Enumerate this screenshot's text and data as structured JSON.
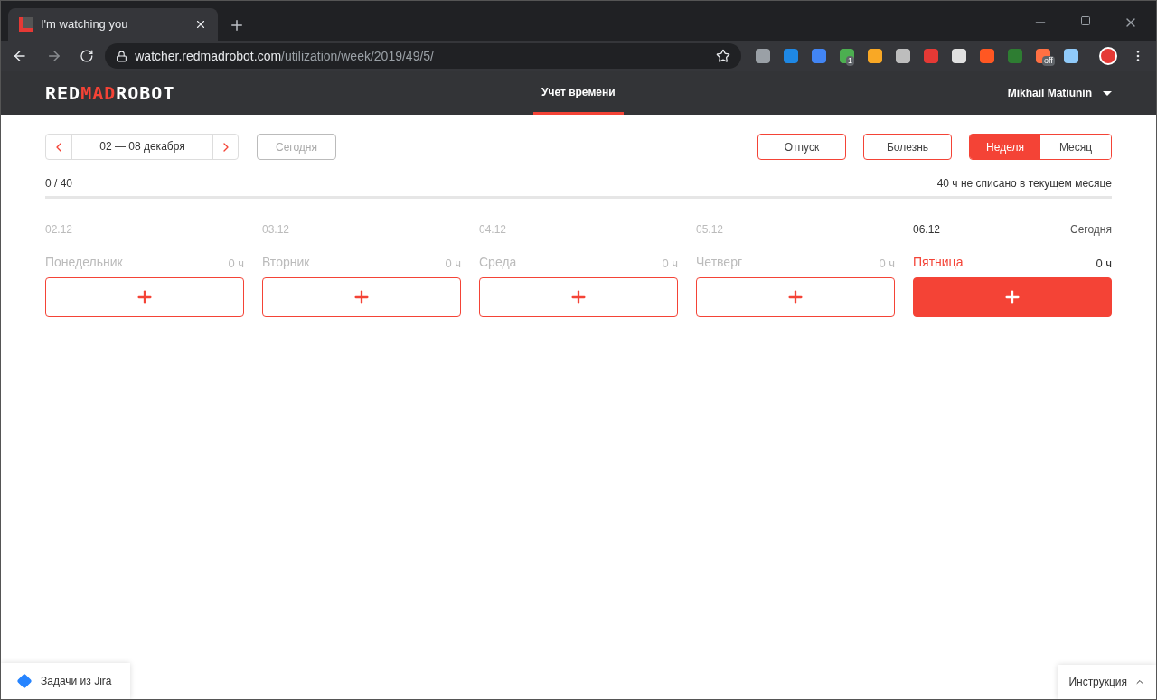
{
  "browser": {
    "tab_title": "I'm watching you",
    "url_host": "watcher.redmadrobot.com",
    "url_path": "/utilization/week/2019/49/5/",
    "extensions": [
      {
        "color": "#9aa0a6"
      },
      {
        "color": "#1e88e5"
      },
      {
        "color": "#4285f4"
      },
      {
        "color": "#4caf50",
        "badge": "1"
      },
      {
        "color": "#f9a825"
      },
      {
        "color": "#bdbdbd"
      },
      {
        "color": "#e53935"
      },
      {
        "color": "#e0e0e0"
      },
      {
        "color": "#ff5722"
      },
      {
        "color": "#2e7d32"
      },
      {
        "color": "#ff7043",
        "badge": "off"
      },
      {
        "color": "#90caf9"
      }
    ]
  },
  "header": {
    "logo": {
      "part1": "RED",
      "part2": "MAD",
      "part3": "ROBOT"
    },
    "nav": [
      {
        "label": "Учет времени",
        "selected": true
      }
    ],
    "user": "Mikhail Matiunin"
  },
  "toolbar": {
    "range": "02 — 08 декабря",
    "today_button": "Сегодня",
    "actions": [
      "Отпуск",
      "Болезнь"
    ],
    "views": [
      {
        "label": "Неделя",
        "selected": true
      },
      {
        "label": "Месяц",
        "selected": false
      }
    ]
  },
  "progress": {
    "reading": "0 / 40",
    "note": "40 ч не списано в текущем месяце"
  },
  "days": [
    {
      "date": "02.12",
      "name": "Понедельник",
      "hours": "0 ч",
      "today": false
    },
    {
      "date": "03.12",
      "name": "Вторник",
      "hours": "0 ч",
      "today": false
    },
    {
      "date": "04.12",
      "name": "Среда",
      "hours": "0 ч",
      "today": false
    },
    {
      "date": "05.12",
      "name": "Четверг",
      "hours": "0 ч",
      "today": false
    },
    {
      "date": "06.12",
      "name": "Пятница",
      "hours": "0 ч",
      "today": true,
      "today_label": "Сегодня"
    }
  ],
  "footer": {
    "jira": "Задачи из Jira",
    "help": "Инструкция"
  }
}
